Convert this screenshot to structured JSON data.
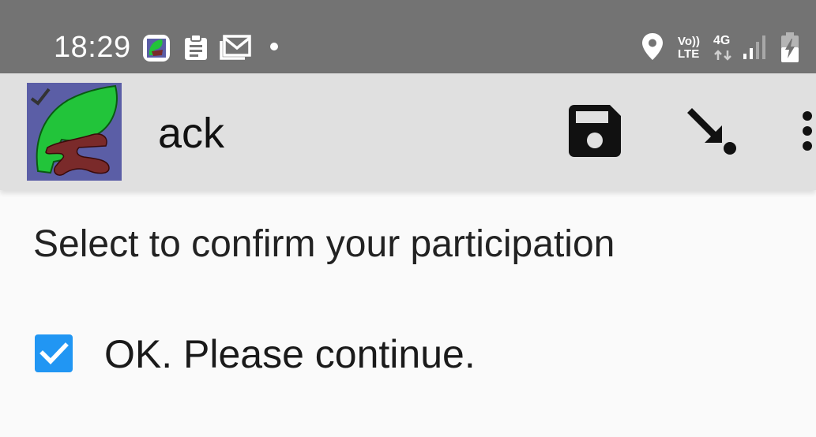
{
  "status_bar": {
    "time": "18:29",
    "network_top": "Vo))",
    "network_bottom": "LTE",
    "signal_type": "4G",
    "icons": [
      "app-notification-icon",
      "clipboard-icon",
      "gmail-icon",
      "dot-icon",
      "location-icon",
      "signal-icon",
      "battery-charging-icon"
    ]
  },
  "app_bar": {
    "title": "ack",
    "actions": [
      "save-icon",
      "go-to-end-icon",
      "more-vert-icon"
    ]
  },
  "content": {
    "prompt": "Select to confirm your participation",
    "choice_label": "OK. Please continue.",
    "choice_checked": true
  },
  "colors": {
    "status_bar": "#737373",
    "app_bar": "#e0e0e0",
    "checkbox": "#2196f3",
    "background": "#fafafa"
  }
}
